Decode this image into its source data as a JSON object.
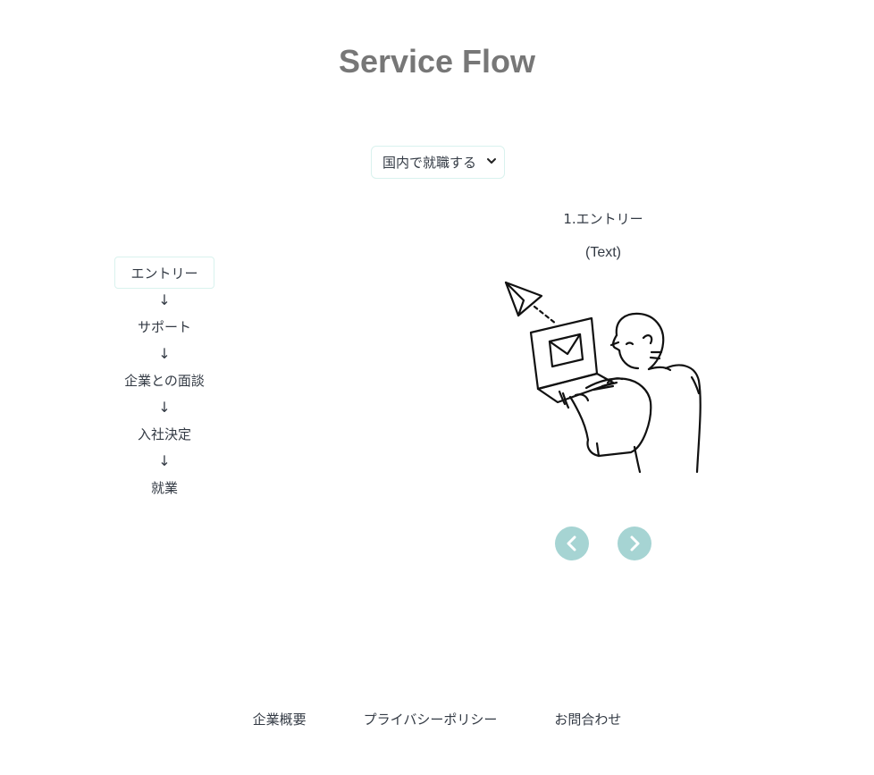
{
  "header": {
    "title": "Service Flow"
  },
  "selector": {
    "selected": "国内で就職する"
  },
  "steps": {
    "items": [
      "エントリー",
      "サポート",
      "企業との面談",
      "入社決定",
      "就業"
    ],
    "arrow": "↓"
  },
  "slide": {
    "title": "1.エントリー",
    "text": "(Text)",
    "illustration_icon": "person-laptop-sending-mail-illustration"
  },
  "carousel": {
    "prev_icon": "chevron-left-icon",
    "next_icon": "chevron-right-icon",
    "button_color": "#a6d4d3"
  },
  "footer": {
    "links": [
      "企業概要",
      "プライバシーポリシー",
      "お問合わせ"
    ]
  }
}
